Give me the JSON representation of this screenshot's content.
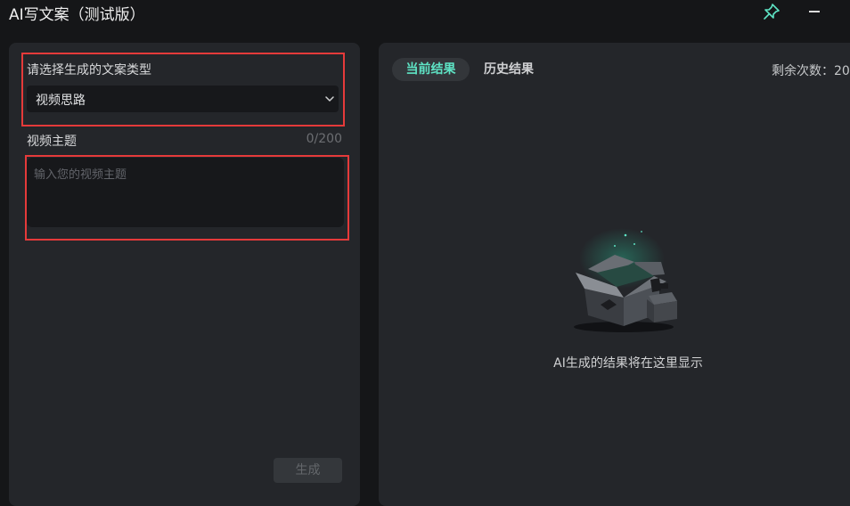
{
  "window": {
    "title": "AI写文案（测试版）",
    "pin_icon": "pin-icon",
    "minimize_icon": "minimize-icon"
  },
  "left": {
    "type_label": "请选择生成的文案类型",
    "type_selected": "视频思路",
    "topic_label": "视频主题",
    "topic_count": "0/200",
    "topic_placeholder": "输入您的视频主题",
    "topic_value": "",
    "generate_button": "生成"
  },
  "right": {
    "tabs": [
      {
        "label": "当前结果",
        "active": true
      },
      {
        "label": "历史结果",
        "active": false
      }
    ],
    "remaining_label": "剩余次数：20",
    "empty_icon": "empty-box-icon",
    "empty_text": "AI生成的结果将在这里显示"
  },
  "colors": {
    "accent": "#5ee3c4",
    "highlight": "#e53a3a",
    "panel": "#24262a",
    "background": "#151618"
  }
}
